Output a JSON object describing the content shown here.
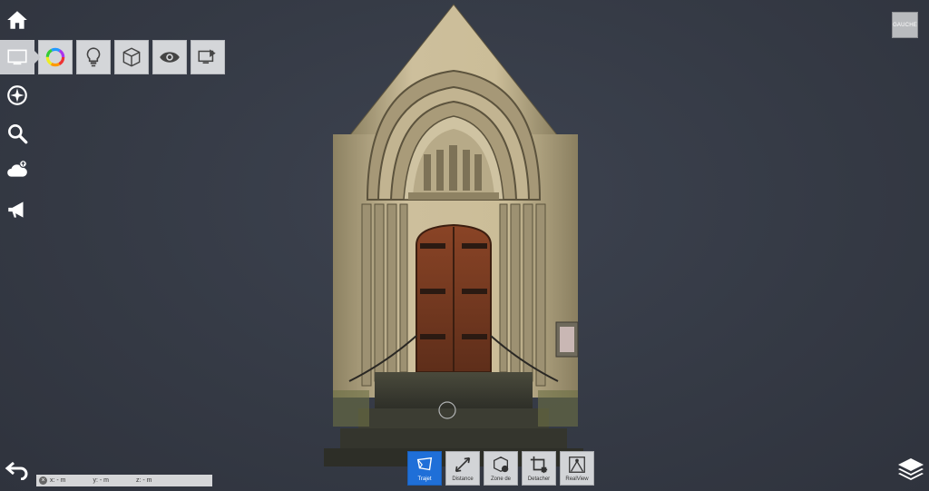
{
  "view": {
    "orientation_label": "GAUCHE"
  },
  "sidebar": {
    "items": [
      {
        "icon": "home-icon"
      },
      {
        "icon": "display-icon"
      },
      {
        "icon": "compass-icon"
      },
      {
        "icon": "search-icon"
      },
      {
        "icon": "cloud-upload-icon"
      },
      {
        "icon": "megaphone-icon"
      }
    ]
  },
  "display_toolbar": {
    "items": [
      {
        "icon": "color-wheel-icon"
      },
      {
        "icon": "lightbulb-icon"
      },
      {
        "icon": "cube-icon"
      },
      {
        "icon": "eye-icon"
      },
      {
        "icon": "screen-export-icon"
      }
    ]
  },
  "bottom_tools": [
    {
      "label": "Trajet",
      "icon": "path-icon",
      "active": true
    },
    {
      "label": "Distance",
      "icon": "distance-icon",
      "active": false
    },
    {
      "label": "Zone de",
      "icon": "zone-icon",
      "active": false
    },
    {
      "label": "Detacher",
      "icon": "crop-icon",
      "active": false
    },
    {
      "label": "RealView",
      "icon": "realview-icon",
      "active": false
    }
  ],
  "coordinates": {
    "x": "x: - m",
    "y": "y: - m",
    "z": "z: - m"
  },
  "colors": {
    "accent": "#1f6fd8",
    "background": "#353a45"
  }
}
